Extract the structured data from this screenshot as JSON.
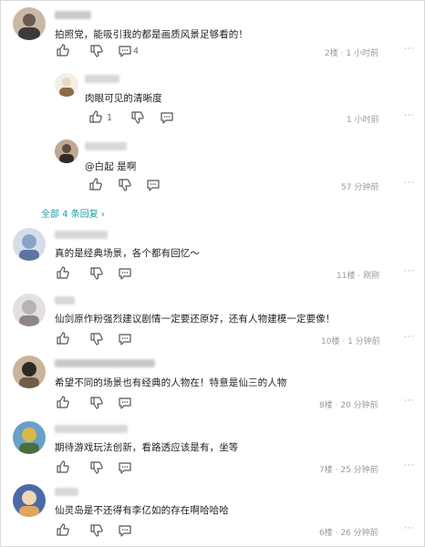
{
  "comments": [
    {
      "text": "拍照党，能吸引我的都是画质风景足够看的！",
      "likes": "",
      "replies": "4",
      "floor": "2楼",
      "time": "1 小时前",
      "avatar_colors": [
        "#6b5a4e",
        "#c9b8a8",
        "#3d3a3a"
      ]
    },
    {
      "text": "真的是经典场景，各个都有回忆～",
      "floor": "11楼",
      "time": "刚刚",
      "avatar_colors": [
        "#8aa3c8",
        "#d6dde8",
        "#5d74a0"
      ]
    },
    {
      "text": "仙剑原作粉强烈建议剧情一定要还原好，还有人物建模一定要像！",
      "floor": "10楼",
      "time": "1 分钟前",
      "avatar_colors": [
        "#b9b2b6",
        "#e4e0e2",
        "#8d8589"
      ]
    },
    {
      "text": "希望不同的场景也有经典的人物在！特意是仙三的人物",
      "floor": "8楼",
      "time": "20 分钟前",
      "avatar_colors": [
        "#2d2a26",
        "#c7b49a",
        "#6e5d4a"
      ]
    },
    {
      "text": "期待游戏玩法创新，看路透应该是有，坐等",
      "floor": "7楼",
      "time": "25 分钟前",
      "avatar_colors": [
        "#d9b84a",
        "#6aa0c8",
        "#4a6e3a"
      ]
    },
    {
      "text": "仙灵岛是不还得有李亿如的存在啊哈哈哈",
      "floor": "6楼",
      "time": "26 分钟前",
      "avatar_colors": [
        "#e0a65a",
        "#4b6aa8",
        "#f2d6b0"
      ]
    }
  ],
  "replies": [
    {
      "text": "肉眼可见的清晰度",
      "likes": "1",
      "time": "1 小时前",
      "avatar_colors": [
        "#e8d9c2",
        "#8b6b4a",
        "#f4efe6"
      ]
    },
    {
      "text": "@白起 是啊",
      "time": "57 分钟前",
      "avatar_colors": [
        "#5b4b3e",
        "#c0a890",
        "#2f2a28"
      ]
    }
  ],
  "expand_label": "全部 4 条回复",
  "expand_arrow": "›",
  "more_label": "···",
  "separator": "·",
  "icons": {
    "like": "thumbs-up-icon",
    "dislike": "thumbs-down-icon",
    "comment": "comment-bubble-icon"
  }
}
